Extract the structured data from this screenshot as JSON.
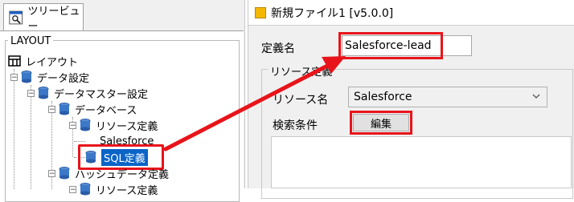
{
  "left_panel": {
    "tab_label": "ツリービュー",
    "group_legend": "LAYOUT",
    "tree": [
      {
        "label": "レイアウト"
      },
      {
        "label": "データ設定"
      },
      {
        "label": "データマスター設定"
      },
      {
        "label": "データベース"
      },
      {
        "label": "リソース定義"
      },
      {
        "label": "Salesforce"
      },
      {
        "label": "SQL定義"
      },
      {
        "label": "ハッシュデータ定義"
      },
      {
        "label": "リソース定義"
      }
    ]
  },
  "right_panel": {
    "window_title": "新規ファイル1 [v5.0.0]",
    "definition_name_label": "定義名",
    "definition_name_value": "Salesforce-lead",
    "resource_group_legend": "リソース定義",
    "resource_name_label": "リソース名",
    "resource_name_selected": "Salesforce",
    "search_condition_label": "検索条件",
    "edit_button_label": "編集"
  },
  "colors": {
    "highlight_red": "#e8141a",
    "selection_blue": "#0a64c8",
    "panel_bg": "#f0f0f0"
  },
  "icons": {
    "tab": "tree-view-icon",
    "layout": "layout-icon",
    "db": "database-icon",
    "window": "window-icon",
    "dropdown": "chevron-down-icon"
  }
}
